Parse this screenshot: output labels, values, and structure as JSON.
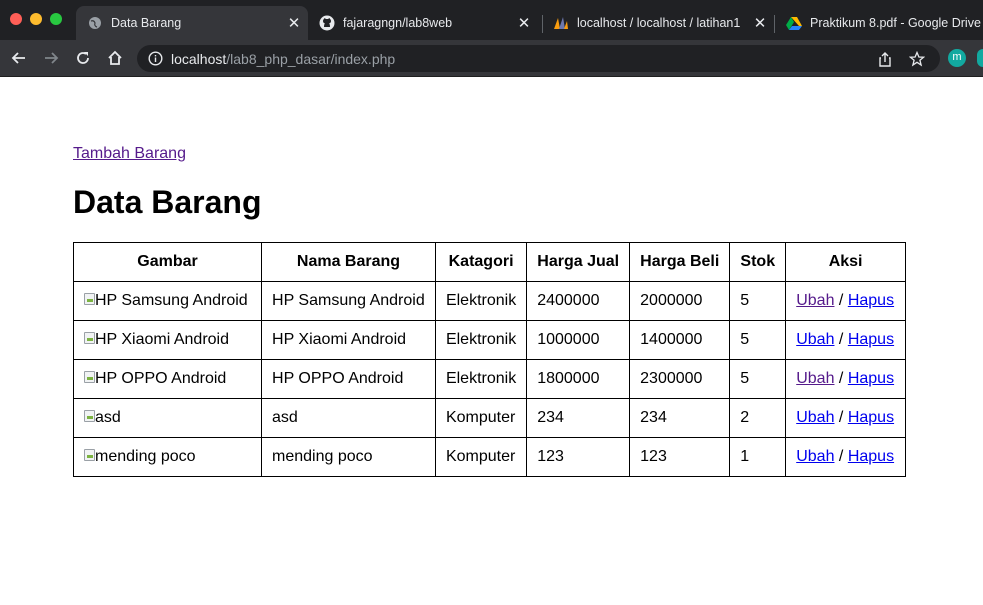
{
  "browser": {
    "tabs": [
      {
        "title": "Data Barang",
        "active": true
      },
      {
        "title": "fajaragngn/lab8web",
        "active": false
      },
      {
        "title": "localhost / localhost / latihan1",
        "active": false
      },
      {
        "title": "Praktikum 8.pdf - Google Drive",
        "active": false
      }
    ],
    "url": {
      "host": "localhost",
      "path": "/lab8_php_dasar/index.php"
    },
    "profile_initial": "m"
  },
  "page": {
    "add_link": "Tambah Barang",
    "title": "Data Barang",
    "table": {
      "headers": [
        "Gambar",
        "Nama Barang",
        "Katagori",
        "Harga Jual",
        "Harga Beli",
        "Stok",
        "Aksi"
      ],
      "rows": [
        {
          "gambar_alt": "HP Samsung Android",
          "nama": "HP Samsung Android",
          "kategori": "Elektronik",
          "harga_jual": "2400000",
          "harga_beli": "2000000",
          "stok": "5",
          "ubah": "Ubah",
          "sep": "/",
          "hapus": "Hapus",
          "ubah_visited": true
        },
        {
          "gambar_alt": "HP Xiaomi Android",
          "nama": "HP Xiaomi Android",
          "kategori": "Elektronik",
          "harga_jual": "1000000",
          "harga_beli": "1400000",
          "stok": "5",
          "ubah": "Ubah",
          "sep": "/",
          "hapus": "Hapus",
          "ubah_visited": false
        },
        {
          "gambar_alt": "HP OPPO Android",
          "nama": "HP OPPO Android",
          "kategori": "Elektronik",
          "harga_jual": "1800000",
          "harga_beli": "2300000",
          "stok": "5",
          "ubah": "Ubah",
          "sep": "/",
          "hapus": "Hapus",
          "ubah_visited": true
        },
        {
          "gambar_alt": "asd",
          "nama": "asd",
          "kategori": "Komputer",
          "harga_jual": "234",
          "harga_beli": "234",
          "stok": "2",
          "ubah": "Ubah",
          "sep": "/",
          "hapus": "Hapus",
          "ubah_visited": false
        },
        {
          "gambar_alt": "mending poco",
          "nama": "mending poco",
          "kategori": "Komputer",
          "harga_jual": "123",
          "harga_beli": "123",
          "stok": "1",
          "ubah": "Ubah",
          "sep": "/",
          "hapus": "Hapus",
          "ubah_visited": false
        }
      ]
    }
  },
  "colors": {
    "visited_link": "#551a8b",
    "unvisited_link": "#0000ee",
    "tab_bar_bg": "#202124",
    "toolbar_bg": "#35363a"
  }
}
